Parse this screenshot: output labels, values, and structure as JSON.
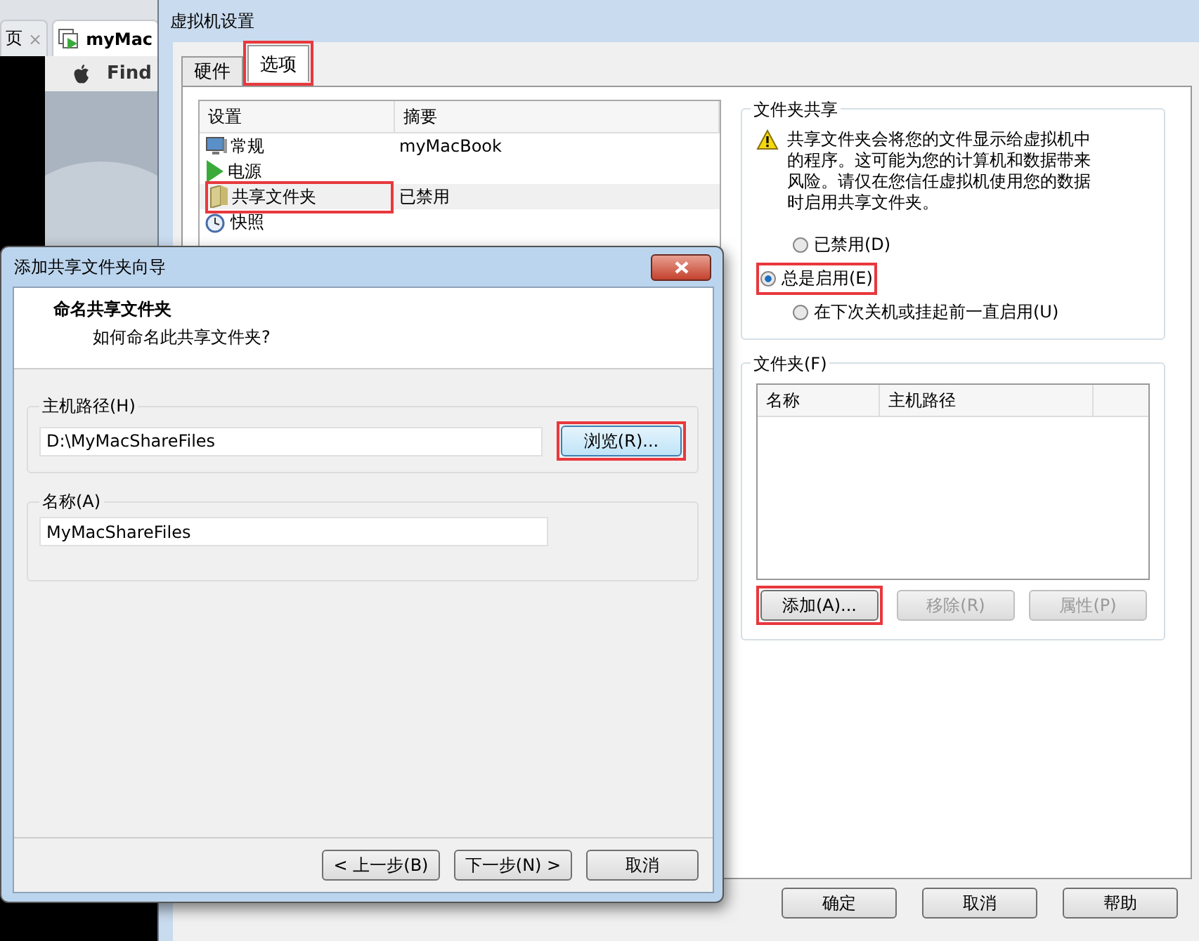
{
  "background_window": {
    "tabs": [
      {
        "label": "页",
        "close": "×",
        "selected": false
      },
      {
        "label": "myMac",
        "selected": true
      }
    ],
    "menu_item": "Find"
  },
  "settings": {
    "title": "虚拟机设置",
    "tabs": [
      {
        "label": "硬件",
        "selected": false,
        "highlighted": false
      },
      {
        "label": "选项",
        "selected": true,
        "highlighted": true
      }
    ],
    "list": {
      "columns": [
        "设置",
        "摘要"
      ],
      "rows": [
        {
          "kind": "monitor",
          "setting": "常规",
          "summary": "myMacBook",
          "selected": false,
          "highlighted": false
        },
        {
          "kind": "play",
          "setting": "电源",
          "selected": false,
          "highlighted": false
        },
        {
          "kind": "folder",
          "setting": "共享文件夹",
          "summary": "已禁用",
          "selected": true,
          "highlighted": true
        },
        {
          "kind": "clock",
          "setting": "快照",
          "selected": false,
          "highlighted": false
        }
      ]
    },
    "sharing": {
      "title": "文件夹共享",
      "warning": "共享文件夹会将您的文件显示给虚拟机中的程序。这可能为您的计算机和数据带来风险。请仅在您信任虚拟机使用您的数据时启用共享文件夹。",
      "options": [
        {
          "label": "已禁用(D)",
          "selected": false,
          "highlighted": false
        },
        {
          "label": "总是启用(E)",
          "selected": true,
          "highlighted": true
        },
        {
          "label": "在下次关机或挂起前一直启用(U)",
          "selected": false,
          "highlighted": false
        }
      ]
    },
    "folders": {
      "title": "文件夹(F)",
      "columns": [
        "名称",
        "主机路径"
      ],
      "buttons": [
        {
          "label": "添加(A)...",
          "disabled": false,
          "highlighted": true
        },
        {
          "label": "移除(R)",
          "disabled": true,
          "highlighted": false
        },
        {
          "label": "属性(P)",
          "disabled": true,
          "highlighted": false
        }
      ]
    },
    "buttons": [
      "确定",
      "取消",
      "帮助"
    ]
  },
  "wizard": {
    "title": "添加共享文件夹向导",
    "heading": "命名共享文件夹",
    "subheading": "如何命名此共享文件夹?",
    "host_path": {
      "label": "主机路径(H)",
      "value": "D:\\MyMacShareFiles",
      "browse": "浏览(R)...",
      "browse_highlighted": true
    },
    "name": {
      "label": "名称(A)",
      "value": "MyMacShareFiles"
    },
    "buttons": [
      "< 上一步(B)",
      "下一步(N) >",
      "取消"
    ]
  }
}
